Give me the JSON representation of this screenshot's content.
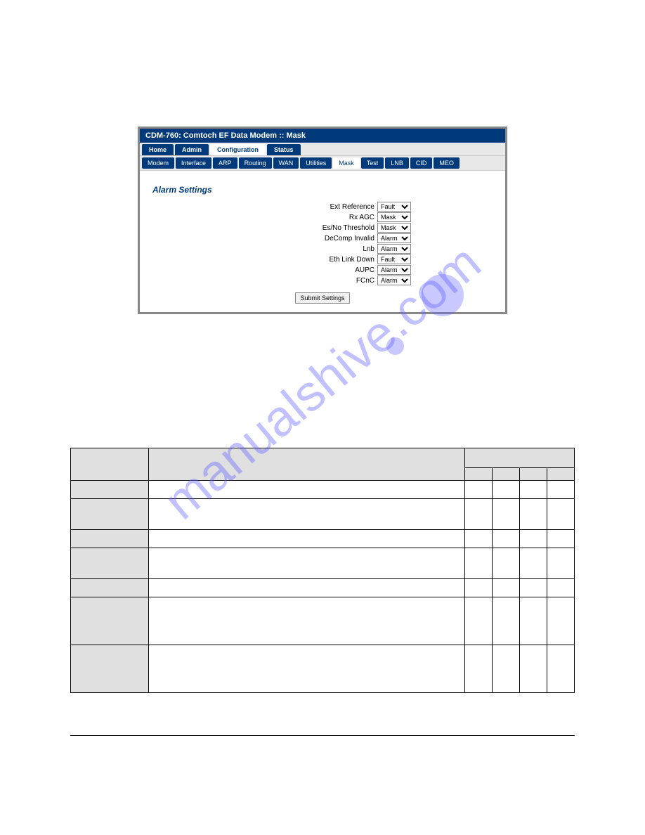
{
  "watermark": "manualshive.com",
  "panel": {
    "title": "CDM-760: Comtoch EF Data Modem :: Mask",
    "primary_tabs": [
      "Home",
      "Admin",
      "Configuration",
      "Status"
    ],
    "primary_active_index": 2,
    "sub_tabs": [
      "Modem",
      "Interface",
      "ARP",
      "Routing",
      "WAN",
      "Utilities",
      "Mask",
      "Test",
      "LNB",
      "CID",
      "MEO"
    ],
    "sub_active_index": 6,
    "section_heading": "Alarm Settings",
    "rows": [
      {
        "label": "Ext Reference",
        "value": "Fault"
      },
      {
        "label": "Rx AGC",
        "value": "Mask"
      },
      {
        "label": "Es/No Threshold",
        "value": "Mask"
      },
      {
        "label": "DeComp Invalid",
        "value": "Alarm"
      },
      {
        "label": "Lnb",
        "value": "Alarm"
      },
      {
        "label": "Eth Link Down",
        "value": "Fault"
      },
      {
        "label": "AUPC",
        "value": "Alarm"
      },
      {
        "label": "FCnC",
        "value": "Alarm"
      }
    ],
    "submit_label": "Submit Settings"
  },
  "table": {
    "rows": [
      {
        "size": "sm"
      },
      {
        "size": "md"
      },
      {
        "size": "sm"
      },
      {
        "size": "md"
      },
      {
        "size": "sm"
      },
      {
        "size": "lg"
      },
      {
        "size": "lg"
      }
    ]
  }
}
